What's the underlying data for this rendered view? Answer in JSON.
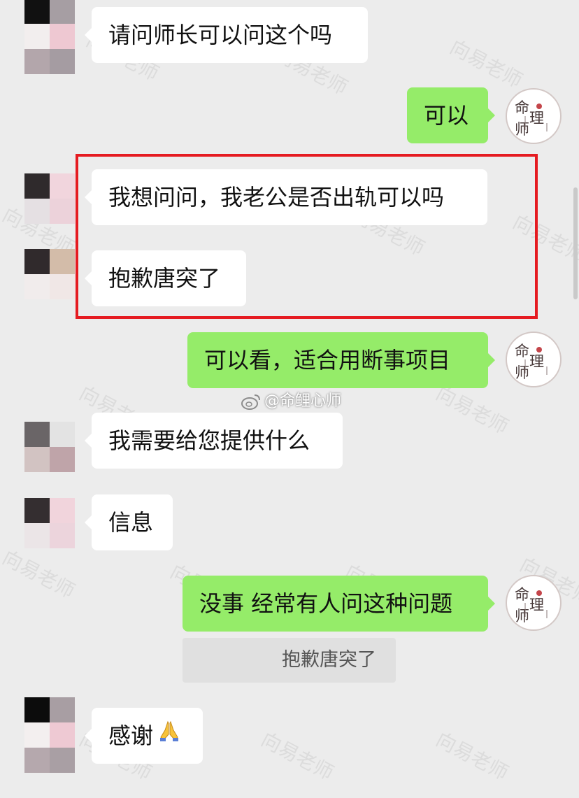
{
  "messages": [
    {
      "side": "left",
      "text": "请问师长可以问这个吗"
    },
    {
      "side": "right",
      "text": "可以"
    },
    {
      "side": "left",
      "text": "我想问问，我老公是否出轨可以吗"
    },
    {
      "side": "left",
      "text": "抱歉唐突了"
    },
    {
      "side": "right",
      "text": "可以看，适合用断事项目"
    },
    {
      "side": "left",
      "text": "我需要给您提供什么"
    },
    {
      "side": "left",
      "text": "信息"
    },
    {
      "side": "right",
      "text": "没事 经常有人问这种问题"
    },
    {
      "side": "quote",
      "text": "抱歉唐突了"
    },
    {
      "side": "left",
      "text": "感谢",
      "emoji": "folded-hands-icon"
    }
  ],
  "source_tag": "@命鲤心师",
  "watermark": "向易老师",
  "self_avatar_text": "命理师",
  "colors": {
    "background": "#ececec",
    "incoming_bubble": "#ffffff",
    "outgoing_bubble": "#95ec69",
    "highlight": "#e51b21",
    "quote_box": "#e0e0e0"
  }
}
